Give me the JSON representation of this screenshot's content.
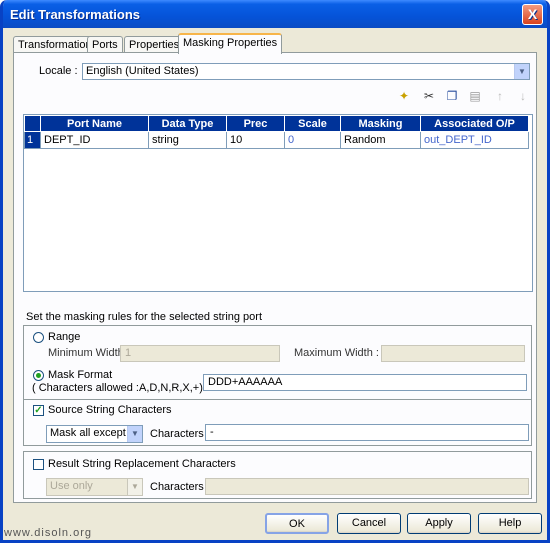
{
  "window": {
    "title": "Edit Transformations",
    "close_glyph": "X"
  },
  "tabs": [
    {
      "label": "Transformation"
    },
    {
      "label": "Ports"
    },
    {
      "label": "Properties"
    },
    {
      "label": "Masking Properties"
    }
  ],
  "locale": {
    "label": "Locale :",
    "value": "English (United States)"
  },
  "toolbar": {
    "icons": [
      "new-icon",
      "cut-icon",
      "copy-icon",
      "paste-icon",
      "move-up-icon",
      "move-down-icon"
    ]
  },
  "grid": {
    "columns": [
      "Port Name",
      "Data Type",
      "Prec",
      "Scale",
      "Masking",
      "Associated O/P"
    ],
    "rows": [
      {
        "num": "1",
        "port_name": "DEPT_ID",
        "data_type": "string",
        "prec": "10",
        "scale": "0",
        "masking": "Random",
        "associated": "out_DEPT_ID"
      }
    ]
  },
  "rules": {
    "title": "Set the masking rules for the selected string port",
    "range_label": "Range",
    "min_width_label": "Minimum Width :",
    "min_width_value": "1",
    "max_width_label": "Maximum Width :",
    "max_width_value": "",
    "mask_format_label": "Mask Format",
    "mask_format_hint": "( Characters allowed :A,D,N,R,X,+)",
    "mask_format_value": "DDD+AAAAAA",
    "source_label": "Source String Characters",
    "source_mode": "Mask all except",
    "source_chars_label": "Characters :",
    "source_chars_value": "-",
    "result_label": "Result String Replacement Characters",
    "result_mode": "Use only",
    "result_chars_label": "Characters :",
    "result_chars_value": ""
  },
  "buttons": {
    "ok": "OK",
    "cancel": "Cancel",
    "apply": "Apply",
    "help": "Help"
  },
  "watermark": "www.disoln.org",
  "colors": {
    "header": "#003399",
    "titlebar": "#0553d8",
    "link": "#4466cc"
  }
}
